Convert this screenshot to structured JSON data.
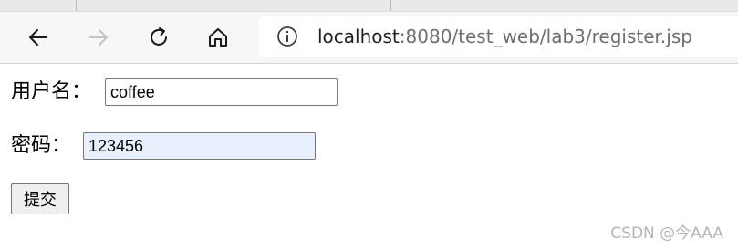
{
  "browser": {
    "url_host": "localhost",
    "url_path": ":8080/test_web/lab3/register.jsp"
  },
  "form": {
    "username_label": "用户名：",
    "username_value": "coffee",
    "password_label": "密码：",
    "password_value": "123456",
    "submit_label": "提交"
  },
  "watermark": "CSDN @今AAA",
  "colors": {
    "autofill_bg": "#e8f0fe",
    "toolbar_bg": "#f7f7f7"
  }
}
